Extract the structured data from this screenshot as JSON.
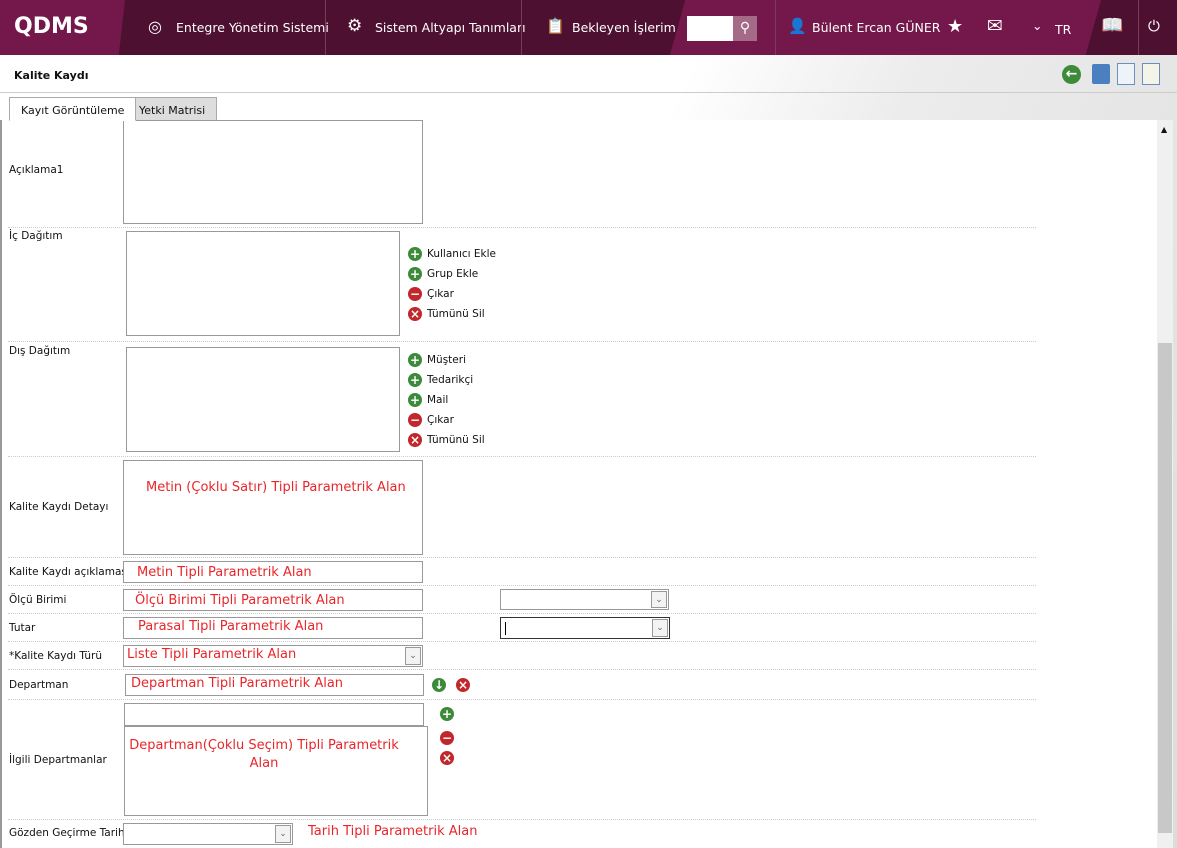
{
  "topbar": {
    "logo": "QDMS",
    "nav": [
      "Entegre Yönetim Sistemi",
      "Sistem Altyapı Tanımları",
      "Bekleyen İşlerim"
    ],
    "search_value": "",
    "user": "Bülent Ercan GÜNER",
    "lang": "TR",
    "colors": {
      "dark": "#4e1030",
      "accent": "#74174a"
    }
  },
  "page": {
    "title": "Kalite Kaydı",
    "tabs": [
      "Kayıt Görüntüleme",
      "Yetki Matrisi"
    ]
  },
  "form": {
    "aciklama1": "Açıklama1",
    "ic_dagitim": {
      "label": "İç Dağıtım",
      "actions": [
        "Kullanıcı Ekle",
        "Grup Ekle",
        "Çıkar",
        "Tümünü Sil"
      ]
    },
    "dis_dagitim": {
      "label": "Dış Dağıtım",
      "actions": [
        "Müşteri",
        "Tedarikçi",
        "Mail",
        "Çıkar",
        "Tümünü Sil"
      ]
    },
    "detay": {
      "label": "Kalite Kaydı Detayı",
      "value": "Metin (Çoklu Satır) Tipli Parametrik Alan"
    },
    "aciklamasi": {
      "label": "Kalite Kaydı açıklaması",
      "value": "Metin Tipli Parametrik Alan"
    },
    "olcu": {
      "label": "Ölçü Birimi",
      "value": "Ölçü Birimi Tipli Parametrik Alan"
    },
    "tutar": {
      "label": "Tutar",
      "value": "Parasal Tipli Parametrik Alan"
    },
    "tur": {
      "label": "*Kalite Kaydı Türü",
      "value": "Liste Tipli Parametrik Alan"
    },
    "departman": {
      "label": "Departman",
      "value": "Departman Tipli Parametrik Alan"
    },
    "ilgili": {
      "label": "İlgili Departmanlar",
      "value": "Departman(Çoklu Seçim) Tipli Parametrik Alan"
    },
    "gozden": {
      "label": "Gözden Geçirme Tarihi",
      "note": "Tarih Tipli Parametrik Alan"
    }
  }
}
